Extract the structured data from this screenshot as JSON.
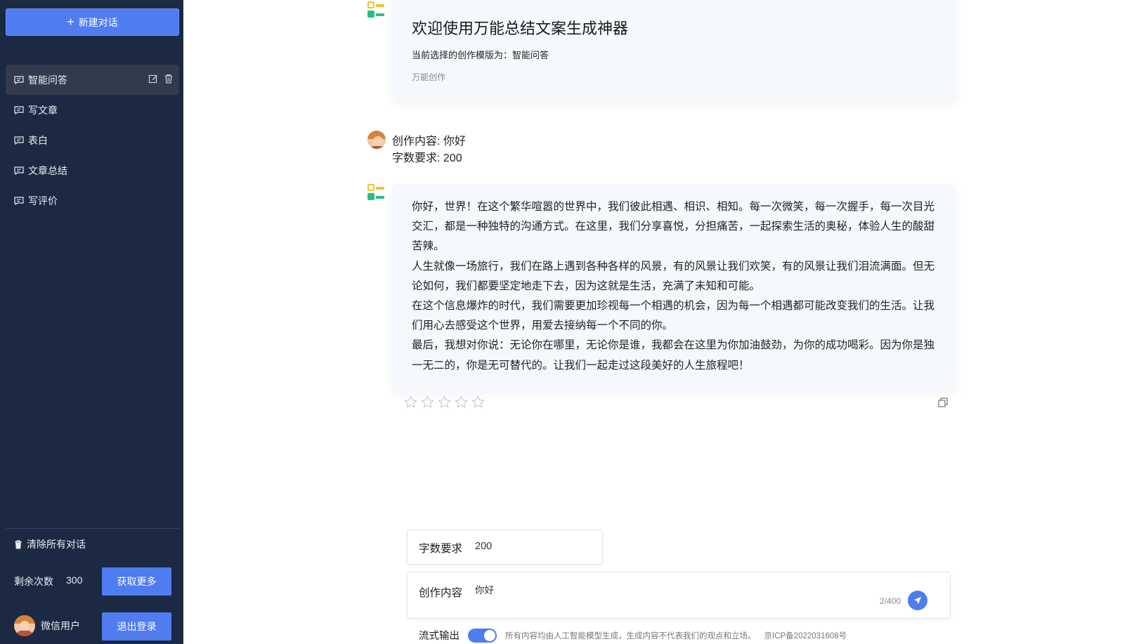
{
  "sidebar": {
    "new_chat_label": "新建对话",
    "items": [
      {
        "label": "智能问答"
      },
      {
        "label": "写文章"
      },
      {
        "label": "表白"
      },
      {
        "label": "文章总结"
      },
      {
        "label": "写评价"
      }
    ],
    "clear_all_label": "清除所有对话",
    "remain_label": "剩余次数",
    "remain_value": "300",
    "get_more_label": "获取更多",
    "user_name": "微信用户",
    "logout_label": "退出登录"
  },
  "welcome": {
    "title": "欢迎使用万能总结文案生成神器",
    "subtitle": "当前选择的创作模版为：智能问答",
    "tag": "万能创作"
  },
  "user_message": {
    "line1": "创作内容: 你好",
    "line2": "字数要求: 200"
  },
  "answer": {
    "paragraphs": [
      "你好，世界！在这个繁华喧嚣的世界中，我们彼此相遇、相识、相知。每一次微笑，每一次握手，每一次目光交汇，都是一种独特的沟通方式。在这里，我们分享喜悦，分担痛苦，一起探索生活的奥秘，体验人生的酸甜苦辣。",
      "人生就像一场旅行，我们在路上遇到各种各样的风景，有的风景让我们欢笑，有的风景让我们泪流满面。但无论如何，我们都要坚定地走下去，因为这就是生活，充满了未知和可能。",
      "在这个信息爆炸的时代，我们需要更加珍视每一个相遇的机会，因为每一个相遇都可能改变我们的生活。让我们用心去感受这个世界，用爱去接纳每一个不同的你。",
      "最后，我想对你说：无论你在哪里，无论你是谁，我都会在这里为你加油鼓劲，为你的成功喝彩。因为你是独一无二的，你是无可替代的。让我们一起走过这段美好的人生旅程吧！"
    ],
    "rating": 0,
    "rating_max": 5
  },
  "input": {
    "word_count_label": "字数要求",
    "word_count_value": "200",
    "content_label": "创作内容",
    "content_value": "你好",
    "char_count": "2/400"
  },
  "footer": {
    "stream_label": "流式输出",
    "stream_enabled": true,
    "disclaimer": "所有内容均由人工智能模型生成，生成内容不代表我们的观点和立场。",
    "icp": "京ICP备2022031608号"
  },
  "colors": {
    "sidebar_bg": "#1c2943",
    "accent": "#4f7cf0",
    "card_bg": "#f5f8fc"
  }
}
